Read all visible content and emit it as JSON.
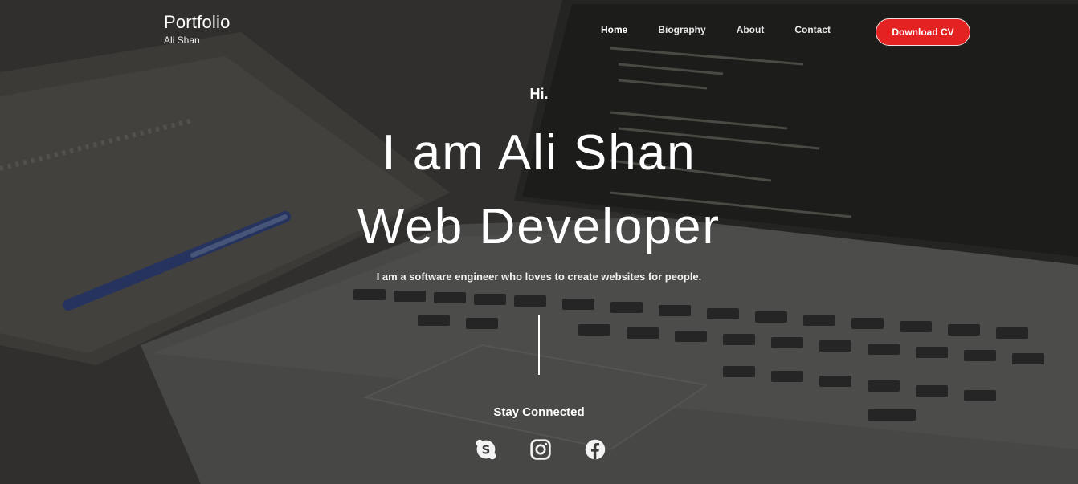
{
  "brand": {
    "title": "Portfolio",
    "subtitle": "Ali Shan"
  },
  "nav": {
    "items": [
      {
        "label": "Home",
        "active": true
      },
      {
        "label": "Biography",
        "active": false
      },
      {
        "label": "About",
        "active": false
      },
      {
        "label": "Contact",
        "active": false
      }
    ]
  },
  "cta": {
    "download_label": "Download CV"
  },
  "hero": {
    "greeting": "Hi.",
    "line1": "I am Ali Shan",
    "line2": "Web Developer",
    "tagline": "I am a software engineer who loves to create websites for people."
  },
  "social": {
    "heading": "Stay Connected",
    "icons": [
      "skype-icon",
      "instagram-icon",
      "facebook-icon"
    ]
  },
  "colors": {
    "accent": "#e52222",
    "text": "#ffffff",
    "background": "#353533"
  }
}
